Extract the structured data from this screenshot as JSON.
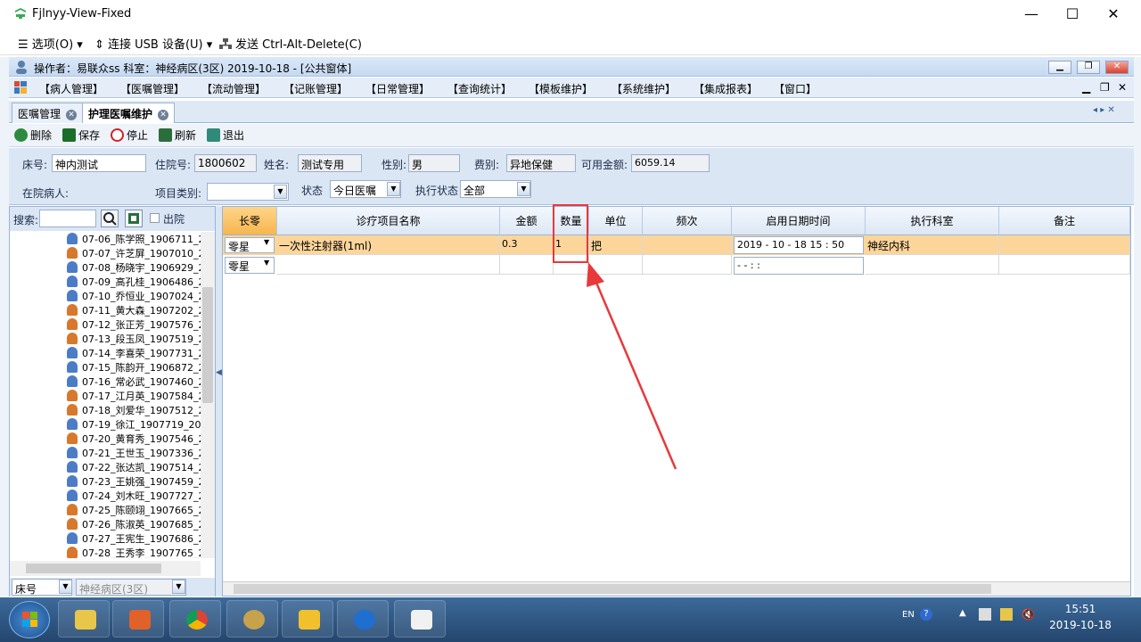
{
  "window": {
    "title": "Fjlnyy-View-Fixed",
    "min": "—",
    "max": "☐",
    "close": "✕"
  },
  "vmbar": {
    "options": "☰ 选项(O) ▾",
    "usb": "⇕ 连接 USB 设备(U) ▾",
    "cad": "发送 Ctrl-Alt-Delete(C)"
  },
  "app": {
    "title": "操作者：易联众ss   科室：神经病区(3区)   2019-10-18 - [公共窗体]"
  },
  "menu": [
    "【病人管理】",
    "【医嘱管理】",
    "【流动管理】",
    "【记账管理】",
    "【日常管理】",
    "【查询统计】",
    "【模板维护】",
    "【系统维护】",
    "【集成报表】",
    "【窗口】"
  ],
  "tabs": [
    {
      "label": "医嘱管理"
    },
    {
      "label": "护理医嘱维护"
    }
  ],
  "toolbar": {
    "delete": "删除",
    "save": "保存",
    "stop": "停止",
    "refresh": "刷新",
    "exit": "退出"
  },
  "form": {
    "bed_label": "床号:",
    "bed_value": "神内测试",
    "admission_label": "住院号:",
    "admission_value": "1800602",
    "name_label": "姓名:",
    "name_value": "测试专用",
    "sex_label": "性别:",
    "sex_value": "男",
    "fee_label": "费别:",
    "fee_value": "异地保健",
    "balance_label": "可用金额:",
    "balance_value": "6059.14",
    "inpatient_label": "在院病人:",
    "category_label": "项目类别:",
    "category_value": "",
    "status_label": "状态",
    "status_value": "今日医嘱",
    "exec_status_label": "执行状态",
    "exec_status_value": "全部"
  },
  "left": {
    "search_label": "搜索:",
    "search_value": "",
    "discharged_label": "出院",
    "patients": [
      "07-06_陈学照_1906711_2",
      "07-07_许芝屏_1907010_2",
      "07-08_杨晓宇_1906929_2",
      "07-09_高孔桂_1906486_2",
      "07-10_乔恒业_1907024_2",
      "07-11_黄大森_1907202_2",
      "07-12_张正芳_1907576_2",
      "07-13_段玉凤_1907519_2",
      "07-14_李喜荣_1907731_2",
      "07-15_陈韵开_1906872_2",
      "07-16_常必武_1907460_2",
      "07-17_江月英_1907584_2",
      "07-18_刘爱华_1907512_2",
      "07-19_徐江_1907719_201",
      "07-20_黄育秀_1907546_2",
      "07-21_王世玉_1907336_2",
      "07-22_张达凯_1907514_2",
      "07-23_王姚强_1907459_2",
      "07-24_刘木旺_1907727_2",
      "07-25_陈颐翊_1907665_2",
      "07-26_陈淑英_1907685_2",
      "07-27_王宪生_1907686_2",
      "07-28_王秀李_1907765_2"
    ],
    "sort_value": "床号",
    "ward_value": "神经病区(3区)"
  },
  "grid": {
    "headers": [
      "长零",
      "诊疗项目名称",
      "金额",
      "数量",
      "单位",
      "频次",
      "启用日期时间",
      "执行科室",
      "备注"
    ],
    "rows": [
      {
        "type": "零星",
        "name": "一次性注射器(1ml)",
        "amount": "0.3",
        "qty": "1",
        "unit": "把",
        "freq": "",
        "date": "2019 - 10 - 18   15 : 50",
        "dept": "神经内科",
        "note": ""
      },
      {
        "type": "零星",
        "name": "",
        "amount": "",
        "qty": "",
        "unit": "",
        "freq": "",
        "date": "  -    -        :    :",
        "dept": "",
        "note": ""
      }
    ]
  },
  "taskbar": {
    "time": "15:51",
    "date": "2019-10-18",
    "lang": "EN"
  },
  "colors": {
    "highlight_row": "#fcd59a",
    "annotation": "#e8393b",
    "accent": "#1f5fa8"
  }
}
